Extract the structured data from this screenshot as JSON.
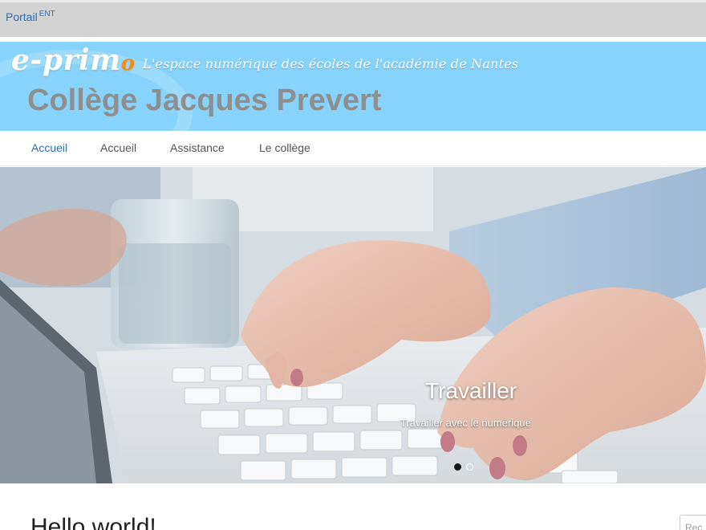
{
  "topbar": {
    "portal_label": "Portail",
    "portal_sup": "ENT"
  },
  "banner": {
    "logo_main": "e-prim",
    "logo_o": "o",
    "tagline": "L'espace numérique des écoles de l'académie de Nantes",
    "site_title": "Collège Jacques Prevert",
    "background_color": "#87d3fb",
    "title_color": "#8e8e8e"
  },
  "nav": {
    "items": [
      {
        "label": "Accueil",
        "active": true
      },
      {
        "label": "Accueil",
        "active": false
      },
      {
        "label": "Assistance",
        "active": false
      },
      {
        "label": "Le collège",
        "active": false
      }
    ],
    "active_color": "#2a6fb0"
  },
  "slider": {
    "title": "Travailler",
    "caption": "Travailler avec le numérique",
    "image_subject": "hands-typing-on-keyboard",
    "slide_count": 2,
    "active_index": 0
  },
  "content": {
    "heading": "Hello world!",
    "search_placeholder": "Rec"
  }
}
